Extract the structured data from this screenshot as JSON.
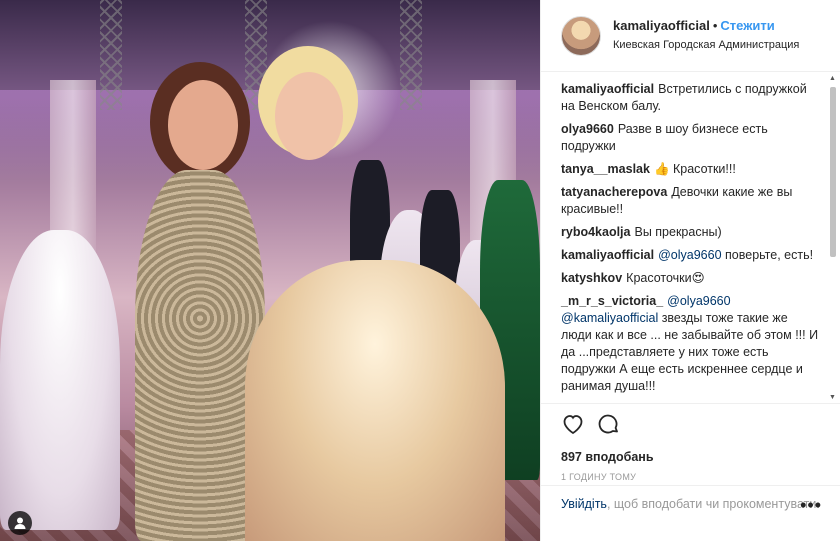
{
  "header": {
    "username": "kamaliyaofficial",
    "separator": "•",
    "follow_label": "Стежити",
    "location": "Киевская Городская Администрация"
  },
  "comments": [
    {
      "user": "kamaliyaofficial",
      "text": "Встретились с подружкой на Венском балу."
    },
    {
      "user": "olya9660",
      "text": "Разве в шоу бизнесе есть подружки"
    },
    {
      "user": "tanya__maslak",
      "text": "👍 Красотки!!!"
    },
    {
      "user": "tatyanacherepova",
      "text": "Девочки какие же вы красивые!!"
    },
    {
      "user": "rybo4kaolja",
      "text": "Вы прекрасны)"
    },
    {
      "user": "kamaliyaofficial",
      "mention": "@olya9660",
      "text": " поверьте, есть!"
    },
    {
      "user": "katyshkov",
      "text": "Красоточки😍"
    },
    {
      "user": "_m_r_s_victoria_",
      "mention": "@olya9660",
      "mention2": "@kamaliyaofficial",
      "text": " звезды тоже такие же люди как и все ... не забывайте об этом !!! И да ...представляете у них тоже есть подружки А еще есть искреннее сердце и ранимая душа!!!"
    }
  ],
  "actions": {
    "likes": "897 вподобань",
    "time": "1 годину тому"
  },
  "login": {
    "link": "Увійдіть",
    "rest": ", щоб вподобати чи прокоментувати."
  },
  "more_label": "•••",
  "icons": [
    "user-tag-icon",
    "heart-icon",
    "comment-icon",
    "more-icon"
  ],
  "colors": {
    "accent": "#3897f0",
    "link": "#003569",
    "muted": "#999999"
  }
}
